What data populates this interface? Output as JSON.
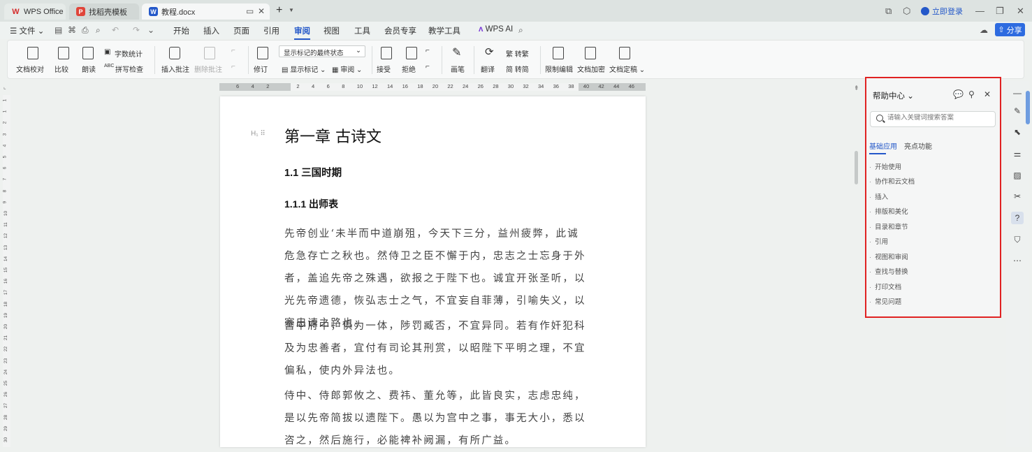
{
  "tabs": [
    {
      "label": "WPS Office"
    },
    {
      "label": "找稻壳模板"
    },
    {
      "label": "教程.docx"
    }
  ],
  "window": {
    "login_label": "立即登录",
    "share_label": "分享"
  },
  "menu": {
    "file_label": "文件",
    "items": [
      "开始",
      "插入",
      "页面",
      "引用",
      "审阅",
      "视图",
      "工具",
      "会员专享",
      "教学工具",
      "WPS AI"
    ],
    "active": "审阅"
  },
  "ribbon": {
    "proofread": "文档校对",
    "compare": "比较",
    "read_aloud": "朗读",
    "word_count": "字数统计",
    "spell_check": "拼写检查",
    "spell_prefix": "ABC",
    "insert_comment": "插入批注",
    "delete_comment": "删除批注",
    "revise": "修订",
    "markup_state": "显示标记的最终状态",
    "show_markup": "显示标记",
    "review": "审阅",
    "accept": "接受",
    "reject": "拒绝",
    "pen": "画笔",
    "translate": "翻译",
    "to_traditional": "转繁",
    "to_simplified": "转简",
    "restrict_edit": "限制编辑",
    "encrypt": "文档加密",
    "finalize": "文档定稿"
  },
  "ruler": {
    "h_numbers": [
      "6",
      "4",
      "2",
      "2",
      "4",
      "6",
      "8",
      "10",
      "12",
      "14",
      "16",
      "18",
      "20",
      "22",
      "24",
      "26",
      "28",
      "30",
      "32",
      "34",
      "36",
      "38",
      "40",
      "42",
      "44",
      "46"
    ],
    "v_numbers": [
      "1",
      "1",
      "2",
      "3",
      "4",
      "5",
      "6",
      "7",
      "8",
      "9",
      "10",
      "11",
      "12",
      "13",
      "14",
      "15",
      "16",
      "17",
      "18",
      "19",
      "20",
      "21",
      "22",
      "23",
      "24",
      "25",
      "26",
      "27",
      "28",
      "29",
      "30"
    ]
  },
  "document": {
    "heading_marker": "H₁",
    "h1": "第一章  古诗文",
    "h2": "1.1  三国时期",
    "h3": "1.1.1  出师表",
    "paragraphs": [
      "先帝创业‘未半而中道崩殂，今天下三分，益州疲弊，此诚危急存亡之秋也。然侍卫之臣不懈于内，忠志之士忘身于外者，盖追先帝之殊遇，欲报之于陛下也。诚宜开张圣听，以光先帝遗德，恢弘志士之气，不宜妄自菲薄，引喻失义，以塞忠谏之路也。",
      "宫中府中，俱为一体，陟罚臧否，不宜异同。若有作奸犯科及为忠善者，宜付有司论其刑赏，以昭陛下平明之理，不宜偏私，使内外异法也。",
      "侍中、侍郎郭攸之、费祎、董允等，此皆良实，志虑忠纯，是以先帝简拔以遗陛下。愚以为宫中之事，事无大小，悉以咨之，然后施行，必能裨补阙漏，有所广益。"
    ]
  },
  "help_panel": {
    "title": "帮助中心",
    "search_placeholder": "请输入关键词搜索答案",
    "tabs": [
      "基础应用",
      "亮点功能"
    ],
    "items": [
      "开始使用",
      "协作和云文档",
      "插入",
      "排版和美化",
      "目录和章节",
      "引用",
      "视图和审阅",
      "查找与替换",
      "打印文档",
      "常见问题"
    ]
  },
  "colors": {
    "accent": "#2458c9",
    "highlight_border": "#e02222",
    "share_bg": "#2d6be0"
  }
}
